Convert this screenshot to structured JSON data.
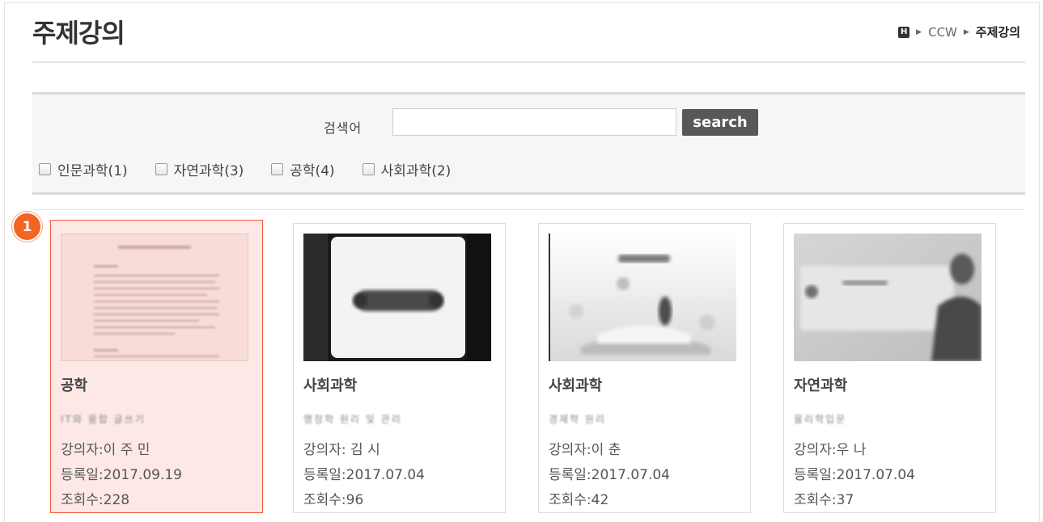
{
  "header": {
    "title": "주제강의",
    "breadcrumb": {
      "home": "H",
      "items": [
        "CCW",
        "주제강의"
      ]
    }
  },
  "search": {
    "label": "검색어",
    "value": "",
    "button": "search"
  },
  "filters": [
    {
      "label": "인문과학(1)",
      "checked": false
    },
    {
      "label": "자연과학(3)",
      "checked": false
    },
    {
      "label": "공학(4)",
      "checked": false
    },
    {
      "label": "사회과학(2)",
      "checked": false
    }
  ],
  "highlight_badge": "1",
  "cards": [
    {
      "category": "공학",
      "title": "IT와 융합 글쓰기",
      "lecturer": "강의자:이 주 민",
      "date": "등록일:2017.09.19",
      "views": "조회수:228",
      "selected": true,
      "thumb": "document"
    },
    {
      "category": "사회과학",
      "title": "행정학 원리 및 관리",
      "lecturer": "강의자: 김 시",
      "date": "등록일:2017.07.04",
      "views": "조회수:96",
      "selected": false,
      "thumb": "tablet"
    },
    {
      "category": "사회과학",
      "title": "경제학 원리",
      "lecturer": "강의자:이 춘",
      "date": "등록일:2017.07.04",
      "views": "조회수:42",
      "selected": false,
      "thumb": "book"
    },
    {
      "category": "자연과학",
      "title": "물리학입문",
      "lecturer": "강의자:우 나",
      "date": "등록일:2017.07.04",
      "views": "조회수:37",
      "selected": false,
      "thumb": "speaker"
    }
  ]
}
